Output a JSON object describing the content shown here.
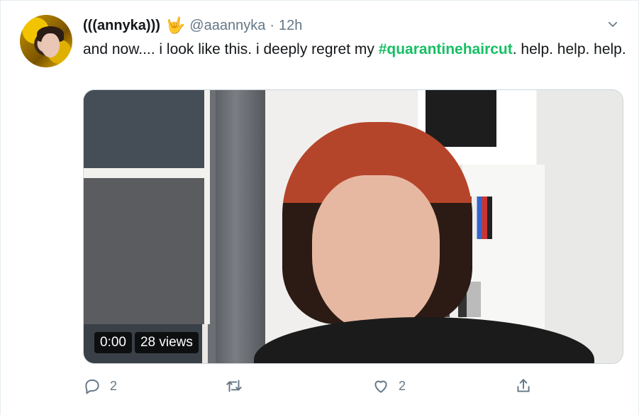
{
  "tweet": {
    "display_name": "(((annyka)))",
    "name_emoji": "🤟",
    "handle": "@aaannyka",
    "separator": "·",
    "time": "12h",
    "text_before": "and now.... i look like this. i deeply regret my ",
    "hashtag": "#quarantinehaircut",
    "text_after": ". help. help. help."
  },
  "media": {
    "timestamp": "0:00",
    "views": "28 views"
  },
  "actions": {
    "reply_count": "2",
    "retweet_count": "",
    "like_count": "2"
  },
  "colors": {
    "hashtag": "#17bf63",
    "muted": "#657786",
    "text": "#14171a"
  },
  "icons": [
    "caret-down-icon",
    "reply-icon",
    "retweet-icon",
    "like-icon",
    "share-icon"
  ]
}
